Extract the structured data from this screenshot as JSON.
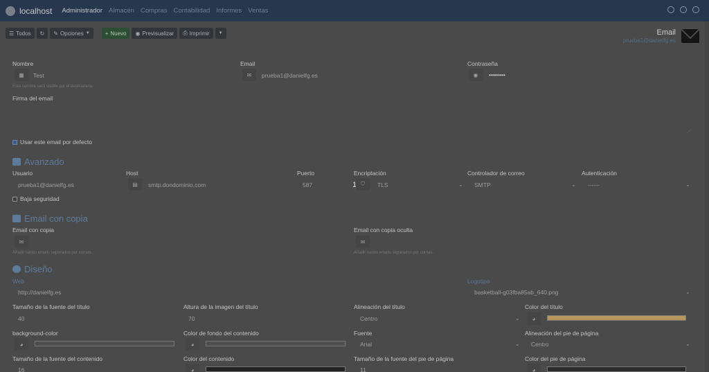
{
  "navbar": {
    "brand": "localhost",
    "links": [
      "Administrador",
      "Almacén",
      "Compras",
      "Contabilidad",
      "Informes",
      "Ventas"
    ]
  },
  "toolbar": {
    "all_label": "Todos",
    "options_label": "Opciones",
    "new_label": "Nuevo",
    "preview_label": "Previsualizar",
    "print_label": "Imprimir"
  },
  "header": {
    "title": "Email",
    "subtitle": "prueba1@danielfg.es"
  },
  "form": {
    "name_label": "Nombre",
    "name_value": "Test",
    "name_help": "Este nombre será visible por el destinatario.",
    "email_label": "Email",
    "email_value": "prueba1@danielfg.es",
    "password_label": "Contraseña",
    "password_value": "••••••••",
    "signature_label": "Firma del email",
    "default_label": "Usar este email por defecto"
  },
  "advanced": {
    "title": "Avanzado",
    "user_label": "Usuario",
    "user_value": "prueba1@danielfg.es",
    "host_label": "Host",
    "host_value": "smtp.dondominio.com",
    "port_label": "Puerto",
    "port_value": "587",
    "encryption_label": "Encriptación",
    "encryption_value": "TLS",
    "mailer_label": "Controlador de correo",
    "mailer_value": "SMTP",
    "auth_label": "Autenticación",
    "auth_value": "------",
    "low_security_label": "Baja seguridad",
    "badge": "1"
  },
  "cc": {
    "title": "Email con copia",
    "cc_label": "Email con copia",
    "cc_help": "Añadir varios emails separados por comas.",
    "bcc_label": "Email con copia oculta",
    "bcc_help": "Añadir varios emails separados por comas."
  },
  "design": {
    "title": "Diseño",
    "web_label": "Web",
    "web_value": "http://danielfg.es",
    "logo_label": "Logotipo",
    "logo_value": "basketball-g03fba85ab_640.png",
    "title_font_size_label": "Tamaño de la fuente del título",
    "title_font_size_value": "40",
    "title_image_height_label": "Altura de la imagen del título",
    "title_image_height_value": "70",
    "title_align_label": "Alineación del título",
    "title_align_value": "Centro",
    "title_color_label": "Color del título",
    "bg_color_label": "background-color",
    "content_bg_label": "Color de fondo del contenido",
    "font_label": "Fuente",
    "font_value": "Arial",
    "footer_align_label": "Alineación del pie de página",
    "footer_align_value": "Centro",
    "content_font_size_label": "Tamaño de la fuente del contenido",
    "content_font_size_value": "16",
    "content_color_label": "Color del contenido",
    "footer_font_size_label": "Tamaño de la fuente del pie de página",
    "footer_font_size_value": "11",
    "footer_color_label": "Color del pie de página"
  },
  "colors": {
    "navbar": "#27374d",
    "accent": "#5e7b9c",
    "title_color": "#b6965a",
    "bg_color": "#4f4f4f",
    "content_bg": "#4f4f4f",
    "content_color": "#222222",
    "footer_color": "#2a2a2a"
  }
}
